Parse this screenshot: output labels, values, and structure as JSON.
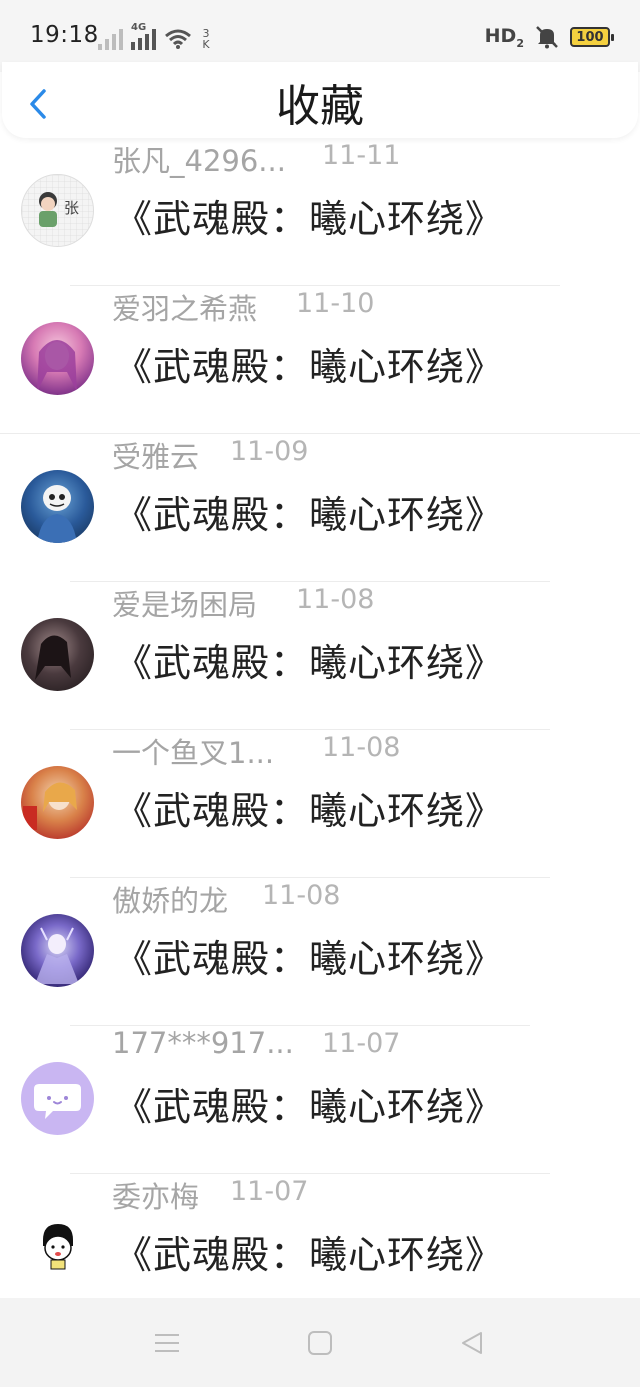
{
  "status_bar": {
    "time": "19:18",
    "network_1": "4G",
    "speed_value": "3",
    "speed_unit": "K",
    "hd": "HD",
    "hd_sub": "2",
    "battery": "100"
  },
  "header": {
    "title": "收藏",
    "back_icon": "chevron-left-icon"
  },
  "favorites": [
    {
      "user": "张凡_4296...",
      "date": "11-11",
      "title": "《武魂殿：曦心环绕》"
    },
    {
      "user": "爱羽之希燕",
      "date": "11-10",
      "title": "《武魂殿：曦心环绕》"
    },
    {
      "user": "受雅云",
      "date": "11-09",
      "title": "《武魂殿：曦心环绕》"
    },
    {
      "user": "爱是场困局",
      "date": "11-08",
      "title": "《武魂殿：曦心环绕》"
    },
    {
      "user": "一个鱼叉1...",
      "date": "11-08",
      "title": "《武魂殿：曦心环绕》"
    },
    {
      "user": "傲娇的龙",
      "date": "11-08",
      "title": "《武魂殿：曦心环绕》"
    },
    {
      "user": "177***917...",
      "date": "11-07",
      "title": "《武魂殿：曦心环绕》"
    },
    {
      "user": "委亦梅",
      "date": "11-07",
      "title": "《武魂殿：曦心环绕》"
    }
  ],
  "avatar_1_text": "张",
  "colors": {
    "accent": "#2b8ae8",
    "username": "#a5a5a5",
    "date": "#b5b5b5",
    "title_text": "#222222",
    "battery": "#f4d03f"
  },
  "nav_bar": {
    "menu_icon": "menu-icon",
    "home_icon": "home-icon",
    "back_icon": "triangle-back-icon"
  }
}
